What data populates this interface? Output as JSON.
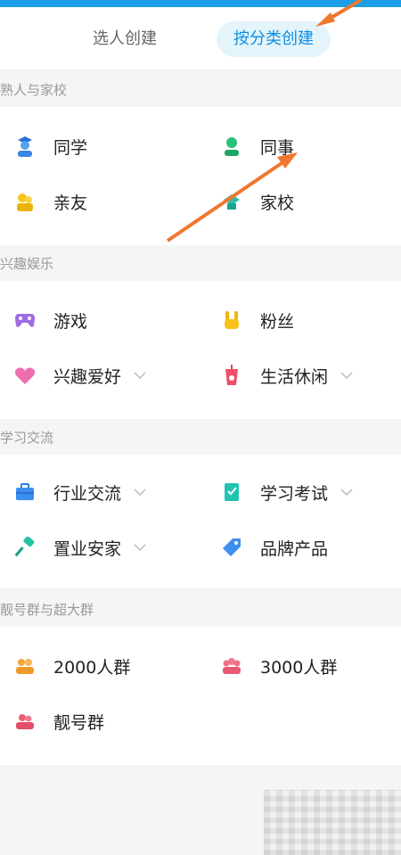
{
  "tabs": {
    "select_people": "选人创建",
    "by_category": "按分类创建"
  },
  "sections": {
    "s1": {
      "title": "熟人与家校",
      "items": [
        {
          "label": "同学",
          "icon": "student-icon"
        },
        {
          "label": "同事",
          "icon": "colleague-icon"
        },
        {
          "label": "亲友",
          "icon": "friends-icon"
        },
        {
          "label": "家校",
          "icon": "school-icon"
        }
      ]
    },
    "s2": {
      "title": "兴趣娱乐",
      "items": [
        {
          "label": "游戏",
          "icon": "gamepad-icon"
        },
        {
          "label": "粉丝",
          "icon": "rock-hand-icon"
        },
        {
          "label": "兴趣爱好",
          "icon": "heart-icon"
        },
        {
          "label": "生活休闲",
          "icon": "drink-icon"
        }
      ]
    },
    "s3": {
      "title": "学习交流",
      "items": [
        {
          "label": "行业交流",
          "icon": "briefcase-icon"
        },
        {
          "label": "学习考试",
          "icon": "exam-icon"
        },
        {
          "label": "置业安家",
          "icon": "brush-icon"
        },
        {
          "label": "品牌产品",
          "icon": "tag-icon"
        }
      ]
    },
    "s4": {
      "title": "靓号群与超大群",
      "items": [
        {
          "label": "2000人群",
          "icon": "group-2000-icon"
        },
        {
          "label": "3000人群",
          "icon": "group-3000-icon"
        },
        {
          "label": "靓号群",
          "icon": "pretty-number-group-icon"
        }
      ]
    }
  },
  "colors": {
    "accent": "#1aa0e8",
    "annotation_arrow": "#f0772f"
  }
}
